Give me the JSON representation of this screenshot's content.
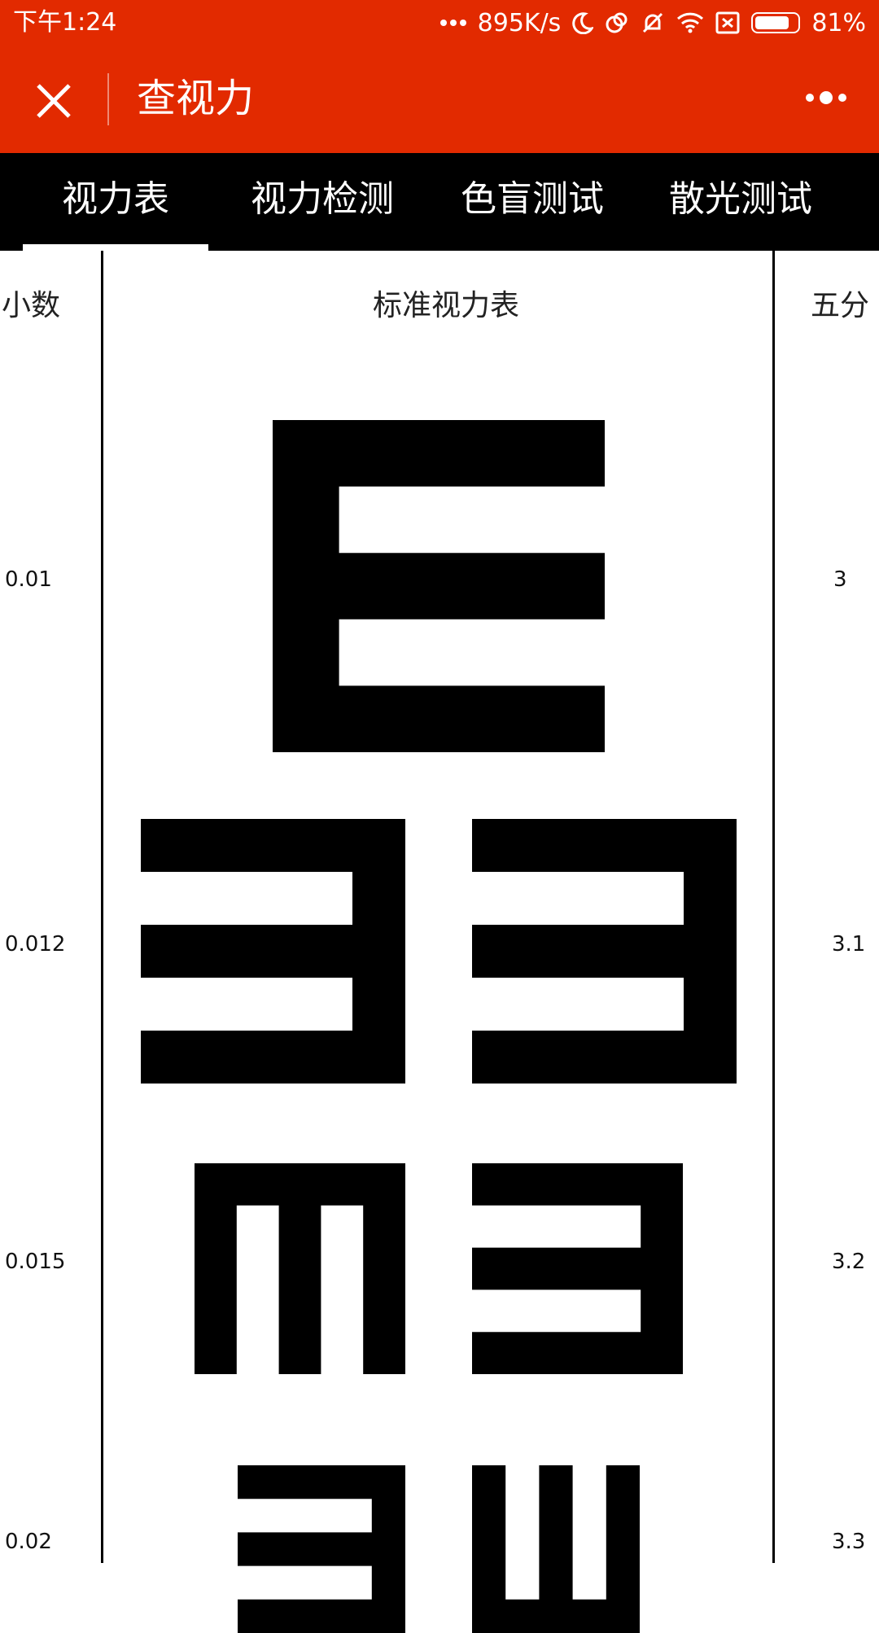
{
  "status_bar": {
    "time": "下午1:24",
    "network_speed": "895K/s",
    "battery_percent": "81%",
    "battery_level": 0.81,
    "icons": [
      "more-dots-icon",
      "moon-icon",
      "sync-icon",
      "bell-off-icon",
      "wifi-icon",
      "sim-x-icon",
      "battery-icon"
    ]
  },
  "title_bar": {
    "title": "查视力",
    "close_icon": "close-icon",
    "more_icon": "more-dots-icon"
  },
  "tabs": [
    {
      "label": "视力表",
      "active": true
    },
    {
      "label": "视力检测",
      "active": false
    },
    {
      "label": "色盲测试",
      "active": false
    },
    {
      "label": "散光测试",
      "active": false
    }
  ],
  "chart": {
    "left_header": "小数",
    "center_header": "标准视力表",
    "right_header": "五分",
    "rows": [
      {
        "decimal": "0.01",
        "five": "3",
        "letters": [
          "E-right"
        ]
      },
      {
        "decimal": "0.012",
        "five": "3.1",
        "letters": [
          "E-left",
          "E-left"
        ]
      },
      {
        "decimal": "0.015",
        "five": "3.2",
        "letters": [
          "E-down",
          "E-left"
        ]
      },
      {
        "decimal": "0.02",
        "five": "3.3",
        "letters": [
          "E-left",
          "E-up"
        ]
      }
    ]
  },
  "colors": {
    "accent": "#e22a00",
    "tab_bar": "#000000",
    "background": "#ffffff"
  }
}
